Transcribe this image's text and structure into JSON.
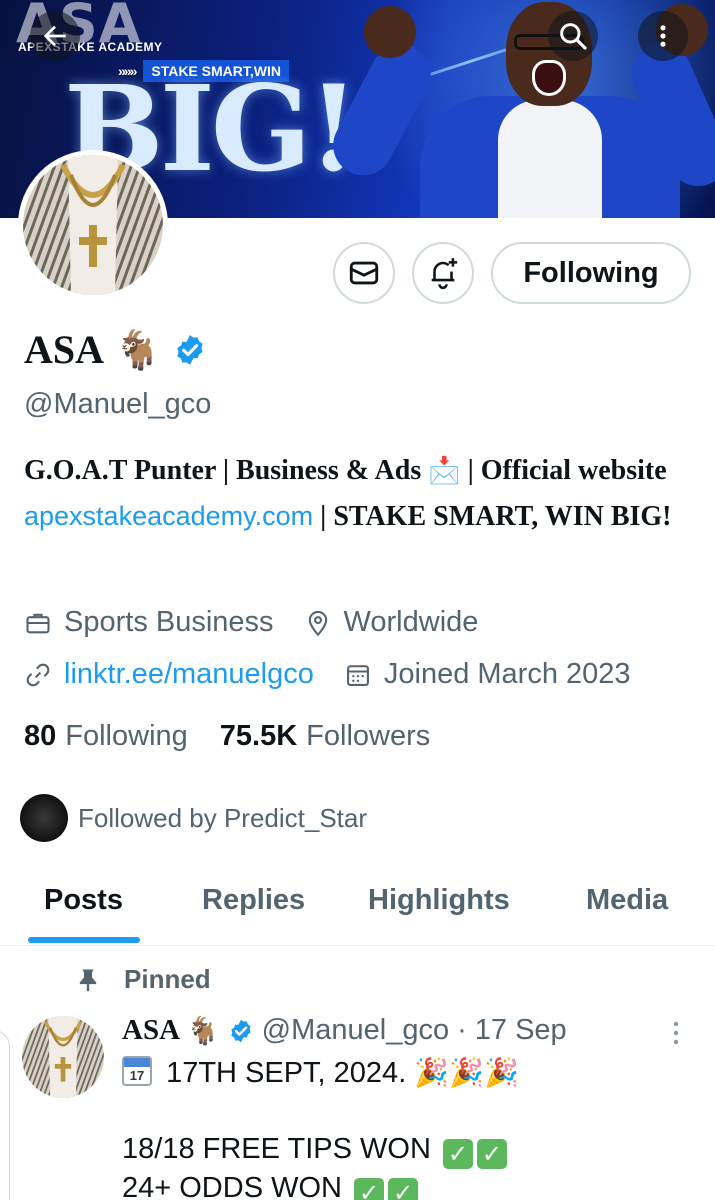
{
  "banner": {
    "brand_title": "ASA",
    "brand_sub": "APEXSTAKE ACADEMY",
    "tagline_arrows": "»»»",
    "tagline": "STAKE SMART,WIN",
    "big_text": "BIG!"
  },
  "profile": {
    "name": "ASA",
    "name_emoji": "🐐",
    "handle": "@Manuel_gco",
    "following_button": "Following",
    "bio": {
      "part1": "G.O.A.T Punter | Business & Ads ",
      "mail_emoji": "📩",
      "part2": " | Official website ",
      "link": "apexstakeacademy.com",
      "part3": " | STAKE SMART, WIN BIG!"
    },
    "category": "Sports Business",
    "location": "Worldwide",
    "website": "linktr.ee/manuelgco",
    "joined": "Joined March 2023",
    "following_count": "80",
    "following_label": "Following",
    "followers_count": "75.5K",
    "followers_label": "Followers",
    "followed_by": "Followed by Predict_Star"
  },
  "tabs": [
    "Posts",
    "Replies",
    "Highlights",
    "Media"
  ],
  "pinned_post": {
    "pinned_label": "Pinned",
    "author": "ASA",
    "author_emoji": "🐐",
    "handle": "@Manuel_gco",
    "separator": "·",
    "date": "17 Sep",
    "calendar_month": "July",
    "calendar_day": "17",
    "line1": "17TH SEPT, 2024.",
    "line2": "18/18 FREE TIPS WON",
    "line3": "24+ ODDS WON"
  },
  "colors": {
    "accent": "#1d9bf0",
    "text_primary": "#0f1419",
    "text_secondary": "#536471",
    "border": "#cfd9de"
  }
}
